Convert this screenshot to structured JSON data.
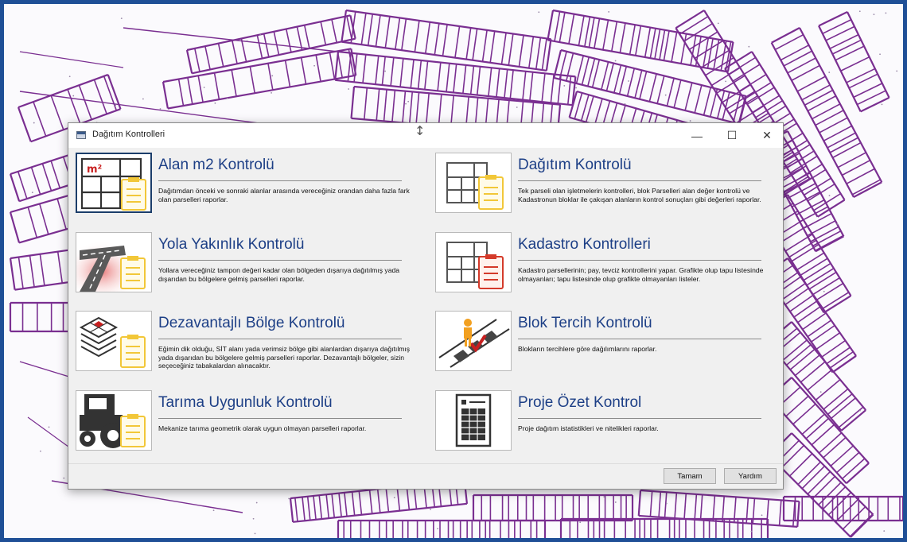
{
  "window": {
    "title": "Dağıtım Kontrolleri",
    "minimize_glyph": "—",
    "maximize_glyph": "☐",
    "close_glyph": "✕",
    "cursor_glyph": "↕"
  },
  "colors": {
    "title_text": "#1d3f86",
    "frame_border": "#1f4f96",
    "map_lines": "#7a2f91",
    "accent_yellow": "#f2c738",
    "accent_red": "#d43a2a"
  },
  "cards": [
    {
      "title": "Alan m2 Kontrolü",
      "icon": "area-m2-icon",
      "description": "Dağıtımdan önceki ve sonraki alanlar arasında vereceğiniz orandan daha fazla fark olan parselleri raporlar."
    },
    {
      "title": "Dağıtım Kontrolü",
      "icon": "distribution-grid-icon",
      "description": "Tek parseli olan işletmelerin kontrolleri, blok Parselleri alan değer kontrolü ve Kadastronun bloklar ile çakışan alanların kontrol sonuçları gibi değerleri raporlar."
    },
    {
      "title": "Yola Yakınlık Kontrolü",
      "icon": "road-proximity-icon",
      "description": "Yollara vereceğiniz tampon değeri kadar olan bölgeden dışarıya dağıtılmış yada dışarıdan bu bölgelere gelmiş parselleri raporlar."
    },
    {
      "title": "Kadastro Kontrolleri",
      "icon": "cadastre-grid-icon",
      "description": "Kadastro parsellerinin; pay, tevciz kontrollerini yapar. Grafikte olup tapu listesinde olmayanları; tapu listesinde olup grafikte olmayanları listeler."
    },
    {
      "title": "Dezavantajlı Bölge Kontrolü",
      "icon": "layers-icon",
      "description": "Eğimin dik olduğu, SİT alanı yada verimsiz bölge gibi alanlardan dışarıya dağıtılmış yada dışarıdan bu bölgelere gelmiş parselleri raporlar. Dezavantajlı bölgeler, sizin seçeceğiniz tabakalardan alınacaktır."
    },
    {
      "title": "Blok Tercih Kontrolü",
      "icon": "block-preference-icon",
      "description": "Blokların tercihlere göre dağılımlarını raporlar."
    },
    {
      "title": "Tarıma Uygunluk Kontrolü",
      "icon": "tractor-icon",
      "description": "Mekanize tarıma geometrik olarak uygun olmayan parselleri raporlar."
    },
    {
      "title": "Proje Özet Kontrol",
      "icon": "report-document-icon",
      "description": "Proje dağıtım istatistikleri ve nitelikleri raporlar."
    }
  ],
  "icon_texts": {
    "area_label": "m²"
  },
  "buttons": {
    "ok": "Tamam",
    "help": "Yardım"
  }
}
